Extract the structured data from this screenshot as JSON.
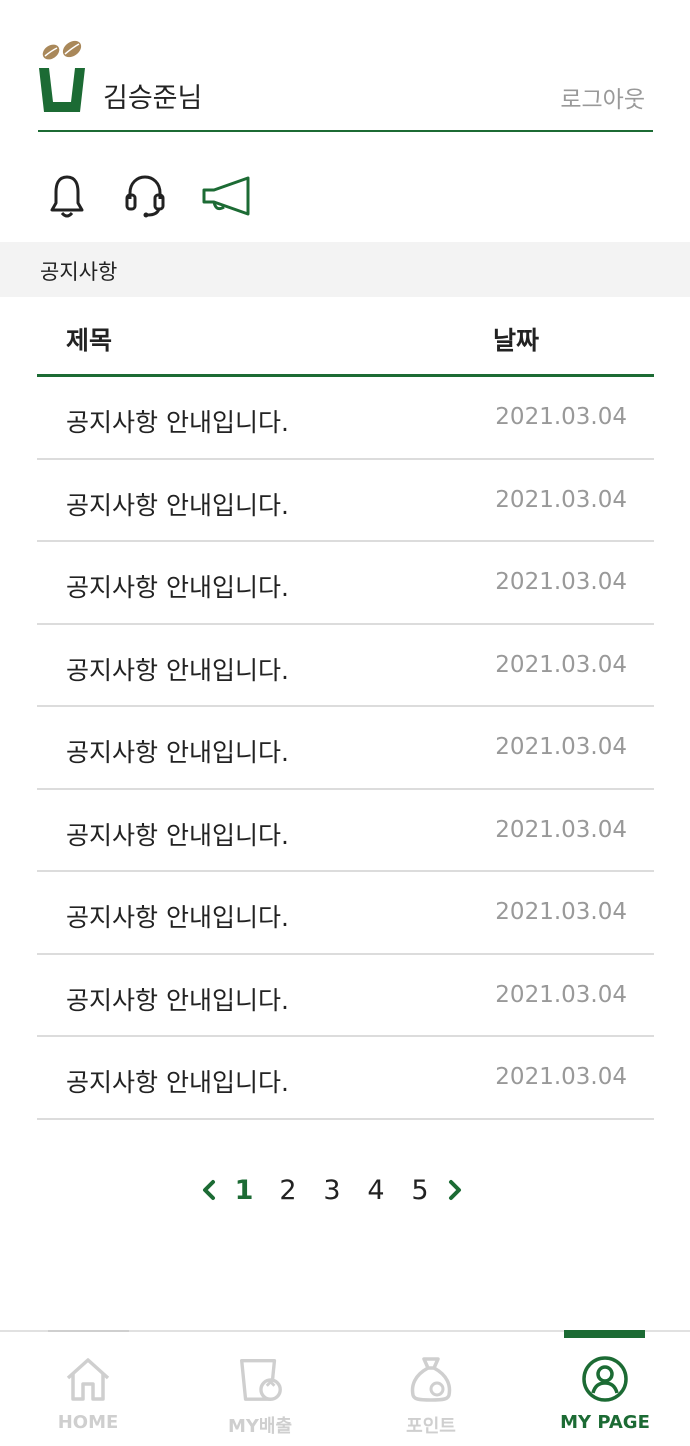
{
  "header": {
    "user_name": "김승준님",
    "logout_label": "로그아웃"
  },
  "icons": {
    "bell": "bell-icon",
    "support": "headset-icon",
    "notice": "megaphone-icon",
    "active": "notice"
  },
  "section": {
    "title": "공지사항"
  },
  "table": {
    "col_title": "제목",
    "col_date": "날짜",
    "rows": [
      {
        "title": "공지사항 안내입니다.",
        "date": "2021.03.04"
      },
      {
        "title": "공지사항 안내입니다.",
        "date": "2021.03.04"
      },
      {
        "title": "공지사항 안내입니다.",
        "date": "2021.03.04"
      },
      {
        "title": "공지사항 안내입니다.",
        "date": "2021.03.04"
      },
      {
        "title": "공지사항 안내입니다.",
        "date": "2021.03.04"
      },
      {
        "title": "공지사항 안내입니다.",
        "date": "2021.03.04"
      },
      {
        "title": "공지사항 안내입니다.",
        "date": "2021.03.04"
      },
      {
        "title": "공지사항 안내입니다.",
        "date": "2021.03.04"
      },
      {
        "title": "공지사항 안내입니다.",
        "date": "2021.03.04"
      }
    ]
  },
  "pagination": {
    "pages": [
      "1",
      "2",
      "3",
      "4",
      "5"
    ],
    "current": "1"
  },
  "tabbar": {
    "home": "HOME",
    "my_emission": "MY배출",
    "points": "포인트",
    "my_page": "MY PAGE",
    "active": "my_page"
  },
  "colors": {
    "accent": "#1c6b34",
    "muted_text": "#999999",
    "inactive_tab": "#cfcfcf",
    "section_bg": "#f3f3f3",
    "coffee_bean": "#a9885a"
  }
}
